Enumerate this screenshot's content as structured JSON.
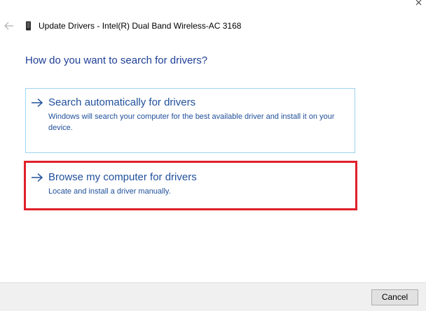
{
  "window": {
    "title": "Update Drivers - Intel(R) Dual Band Wireless-AC 3168"
  },
  "page": {
    "heading": "How do you want to search for drivers?"
  },
  "options": [
    {
      "title": "Search automatically for drivers",
      "description": "Windows will search your computer for the best available driver and install it on your device."
    },
    {
      "title": "Browse my computer for drivers",
      "description": "Locate and install a driver manually."
    }
  ],
  "footer": {
    "cancel_label": "Cancel"
  },
  "colors": {
    "heading": "#1f3f96",
    "link": "#1f4f9a",
    "option_border": "#9fd3f0",
    "highlight": "#e0202a",
    "footer_bg": "#f0f0f0"
  },
  "icons": {
    "close": "close-icon",
    "back": "back-arrow-icon",
    "device": "device-icon",
    "option_arrow": "arrow-right-icon"
  }
}
